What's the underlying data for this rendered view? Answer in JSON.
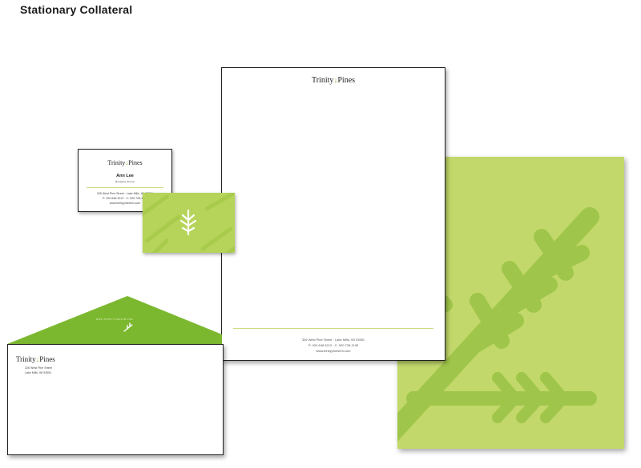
{
  "page": {
    "title": "Stationary Collateral"
  },
  "brand": {
    "name_left": "Trinity",
    "name_right": "Pines",
    "primary_color": "#7cb82f",
    "light_color": "#c2d86a",
    "sprig_glyph": "↓"
  },
  "letterhead": {
    "address_line": "326 West Pine Street  ⋅  Lake Mills, WI 53551",
    "phone_line": "P: 920.648.3212  ⋅  C: 920.728-1195",
    "website": "www.trinitypineshm.com"
  },
  "business_card": {
    "name": "Ann Lee",
    "title": "Managing Director",
    "address_line": "326 West Pine Street  ⋅  Lake Mills, WI 53551",
    "phone_line": "P: 920.648.3212  ⋅  C: 920.728-1195",
    "website": "www.trinitypineshm.com"
  },
  "envelope": {
    "address_line_1": "326 West Pine Street",
    "address_line_2": "Lake Mills, WI 53551",
    "flap_text": "WWW.TRINITYPINESHM.COM"
  }
}
